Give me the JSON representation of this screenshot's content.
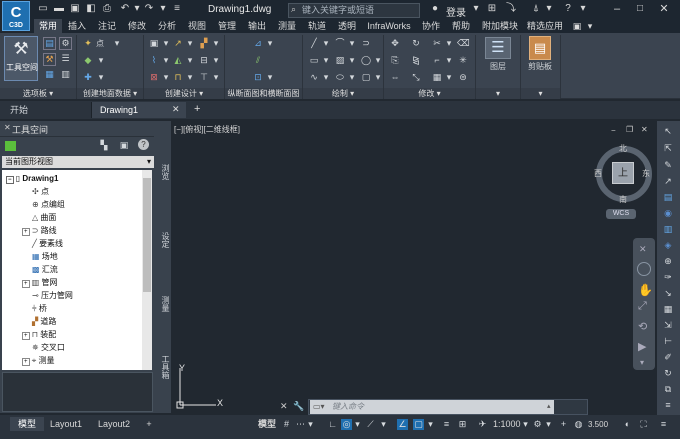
{
  "app": {
    "logo_text": "C",
    "logo_sub": "C3D",
    "document_title": "Drawing1.dwg"
  },
  "search": {
    "placeholder": "键入关键字或短语"
  },
  "user": {
    "login_label": "登录"
  },
  "ribbon_tabs": [
    "常用",
    "插入",
    "注记",
    "修改",
    "分析",
    "视图",
    "管理",
    "输出",
    "测量",
    "轨道",
    "透明",
    "InfraWorks",
    "协作",
    "帮助",
    "附加模块",
    "精选应用"
  ],
  "ribbon_tab_active": "常用",
  "ribbon": {
    "big_tool_label": "工具空间",
    "panels": [
      "选项板",
      "创建地面数据",
      "创建设计",
      "纵断面图和横断面图",
      "绘制",
      "修改",
      "图层",
      "剪贴板"
    ],
    "point_label": "点",
    "layer_label": "图层",
    "clipboard_label": "剪贴板"
  },
  "file_tabs": [
    "开始",
    "Drawing1"
  ],
  "palette": {
    "title": "工具空间",
    "view_selector": "当前图形视图",
    "tree_root": "Drawing1",
    "tree_items": [
      "点",
      "点编组",
      "曲面",
      "路线",
      "要素线",
      "场地",
      "汇流",
      "管网",
      "压力管网",
      "桥",
      "道路",
      "装配",
      "交叉口",
      "测量"
    ],
    "vertical_tabs": [
      "浏览",
      "设定",
      "测量",
      "工具箱"
    ]
  },
  "viewport": {
    "label": "[−][俯视][二维线框]"
  },
  "viewcube": {
    "face": "上",
    "north": "北",
    "south": "南",
    "east": "东",
    "west": "西",
    "wcs": "WCS"
  },
  "command_line": {
    "placeholder": "键入命令"
  },
  "ucs": {
    "x_label": "X",
    "y_label": "Y"
  },
  "status_bar": {
    "tabs": [
      "模型",
      "Layout1",
      "Layout2"
    ],
    "model_label": "模型",
    "scale": "1:1000",
    "annotation_scale": "3.500"
  },
  "colors": {
    "title_bg": "#1d2630",
    "ribbon_bg": "#3b4450",
    "canvas_bg": "#212830",
    "accent": "#1f6fb0"
  }
}
